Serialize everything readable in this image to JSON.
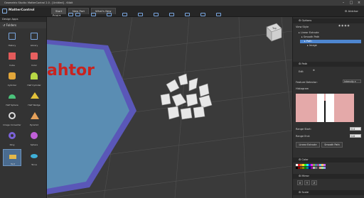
{
  "window": {
    "title": "Geometrix Studio: MatterControl 2.0 - [Untitled] - 64bit",
    "controls": [
      "–",
      "□",
      "×"
    ]
  },
  "menubar": {
    "app_name": "MatterControl",
    "tabs": [
      {
        "label": "Start"
      },
      {
        "label": "New Part"
      },
      {
        "label": "What's New"
      }
    ],
    "print_label": "Print",
    "user_label": "Aldchor"
  },
  "leftpanel": {
    "header": "Design Apps",
    "folders_label": "Folders",
    "items": [
      {
        "label": "History",
        "icon": "history-icon"
      },
      {
        "label": "Library",
        "icon": "library-icon"
      },
      {
        "label": "Cube",
        "icon": "cube-icon"
      },
      {
        "label": "Color",
        "icon": "color-icon"
      },
      {
        "label": "Cylinder",
        "icon": "cylinder-icon"
      },
      {
        "label": "Half Cylinder",
        "icon": "half-cylinder-icon"
      },
      {
        "label": "Half Sphere",
        "icon": "half-sphere-icon"
      },
      {
        "label": "Half Wedge",
        "icon": "half-wedge-icon"
      },
      {
        "label": "Image Converter",
        "icon": "image-converter-icon"
      },
      {
        "label": "Pyramid",
        "icon": "pyramid-icon"
      },
      {
        "label": "Ring",
        "icon": "ring-icon"
      },
      {
        "label": "Sphere",
        "icon": "sphere-icon"
      },
      {
        "label": "Text",
        "icon": "text-icon"
      },
      {
        "label": "Torus",
        "icon": "torus-icon"
      }
    ]
  },
  "viewport": {
    "text_object": "ahtor",
    "view_cube_label": "Top"
  },
  "rightpanel": {
    "options_label": "Options",
    "view_style_label": "View Style",
    "tree": [
      {
        "label": "Linear Extrude"
      },
      {
        "label": "Smooth Path"
      },
      {
        "label": "Path"
      },
      {
        "label": "Image"
      }
    ],
    "path_section": "Path",
    "edit_label": "Edit",
    "feature_detector_label": "Feature Detector:",
    "feature_detector_value": "Intensity",
    "histogram_label": "Histogram",
    "range_start_label": "Range Start:",
    "range_start_value": "0.4",
    "range_end_label": "Range End:",
    "range_end_value": "0.6",
    "linear_extrude_button": "Linear Extrude",
    "smooth_path_button": "Smooth Path",
    "color_section": "Color",
    "mirror_section": "Mirror",
    "mirror_axes": [
      "X",
      "Y",
      "Z"
    ],
    "scale_section": "Scale"
  },
  "colors": {
    "accent": "#4e86d0",
    "text_object": "#c8231f",
    "polygon_fill": "#5a8db3",
    "polygon_border": "#5b57b8"
  }
}
